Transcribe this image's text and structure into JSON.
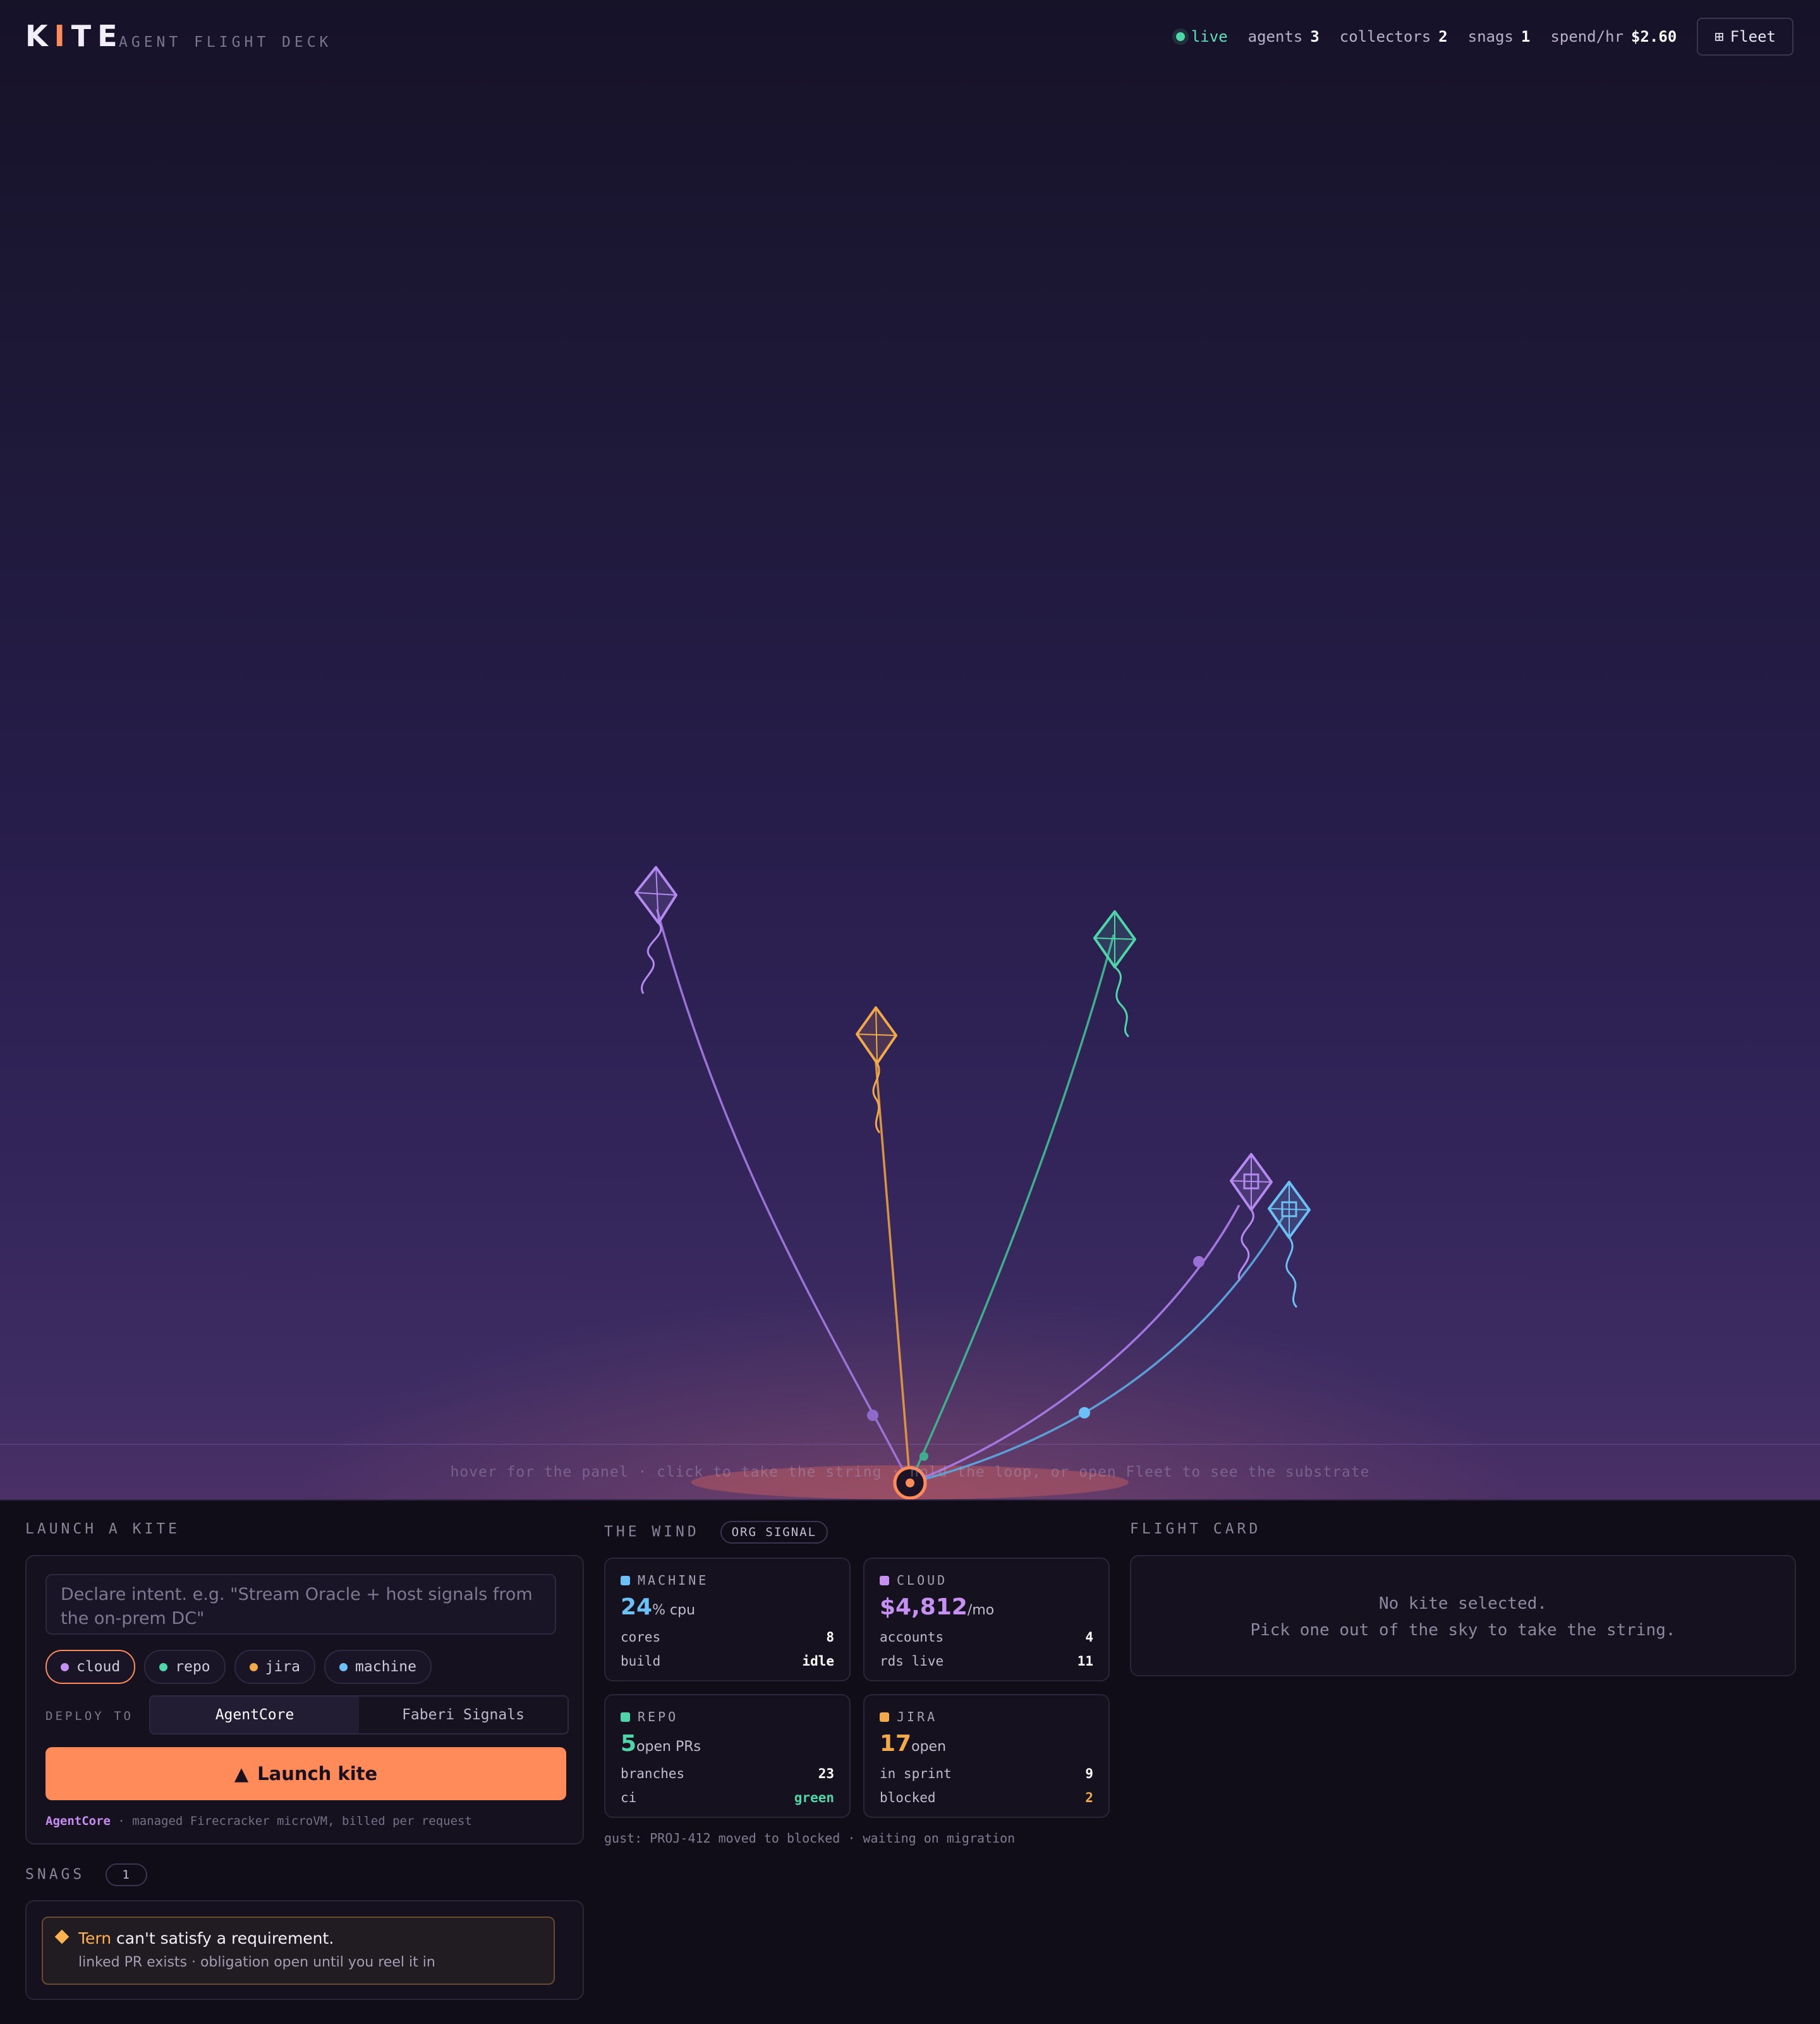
{
  "header": {
    "logo_k": "K",
    "logo_i": "I",
    "logo_te": "TE",
    "subtitle": "AGENT FLIGHT DECK",
    "live_label": "live",
    "stats": [
      {
        "label": "agents",
        "value": "3"
      },
      {
        "label": "collectors",
        "value": "2"
      },
      {
        "label": "snags",
        "value": "1"
      },
      {
        "label": "spend/hr",
        "value": "$2.60"
      }
    ],
    "fleet_icon": "⊞",
    "fleet_label": "Fleet"
  },
  "sky": {
    "hint": "hover for the panel · click to take the string · hold the loop, or open Fleet to see the substrate",
    "kites": [
      {
        "name": "kite-cloud",
        "color": "#b48af0",
        "kind": "agent"
      },
      {
        "name": "kite-jira",
        "color": "#f2a94b",
        "kind": "agent"
      },
      {
        "name": "kite-repo",
        "color": "#4fd6a8",
        "kind": "agent"
      },
      {
        "name": "kite-collector-cloud",
        "color": "#b48af0",
        "kind": "collector"
      },
      {
        "name": "kite-collector-machine",
        "color": "#6cc0f5",
        "kind": "collector"
      }
    ]
  },
  "launch": {
    "section_label": "LAUNCH A KITE",
    "intent_placeholder": "Declare intent. e.g. \"Stream Oracle + host signals from the on-prem DC\"",
    "chips": [
      {
        "label": "cloud",
        "color": "#c690f2",
        "active": true
      },
      {
        "label": "repo",
        "color": "#4fd6a8",
        "active": false
      },
      {
        "label": "jira",
        "color": "#f2a94b",
        "active": false
      },
      {
        "label": "machine",
        "color": "#6cc0f5",
        "active": false
      }
    ],
    "deploy_label": "DEPLOY TO",
    "deploy_options": [
      "AgentCore",
      "Faberi Signals"
    ],
    "deploy_selected": "AgentCore",
    "launch_icon": "▲",
    "launch_label": "Launch kite",
    "note_brand": "AgentCore",
    "note_text": " · managed Firecracker microVM, billed per request"
  },
  "snags": {
    "section_label": "SNAGS",
    "count": "1",
    "items": [
      {
        "who": "Tern",
        "title": " can't satisfy a requirement.",
        "sub": "linked PR exists · obligation open until you reel it in"
      }
    ]
  },
  "wind": {
    "section_label": "THE WIND",
    "badge": "ORG SIGNAL",
    "cards": [
      {
        "title": "MACHINE",
        "color": "#6cc0f5",
        "big": "24",
        "unit": "% cpu",
        "rows": [
          {
            "k": "cores",
            "v": "8",
            "c": "#ffffff"
          },
          {
            "k": "build",
            "v": "idle",
            "c": "#ffffff"
          }
        ]
      },
      {
        "title": "CLOUD",
        "color": "#c690f2",
        "big": "$4,812",
        "unit": "/mo",
        "rows": [
          {
            "k": "accounts",
            "v": "4",
            "c": "#ffffff"
          },
          {
            "k": "rds live",
            "v": "11",
            "c": "#ffffff"
          }
        ]
      },
      {
        "title": "REPO",
        "color": "#4fd6a8",
        "big": "5",
        "unit": "open PRs",
        "rows": [
          {
            "k": "branches",
            "v": "23",
            "c": "#ffffff"
          },
          {
            "k": "ci",
            "v": "green",
            "c": "#4fd6a8"
          }
        ]
      },
      {
        "title": "JIRA",
        "color": "#f2a94b",
        "big": "17",
        "unit": "open",
        "rows": [
          {
            "k": "in sprint",
            "v": "9",
            "c": "#ffffff"
          },
          {
            "k": "blocked",
            "v": "2",
            "c": "#f2a94b"
          }
        ]
      }
    ],
    "gust": "gust: PROJ-412 moved to blocked · waiting on migration"
  },
  "flight_card": {
    "section_label": "FLIGHT CARD",
    "empty_line1": "No kite selected.",
    "empty_line2": "Pick one out of the sky to take the string."
  }
}
